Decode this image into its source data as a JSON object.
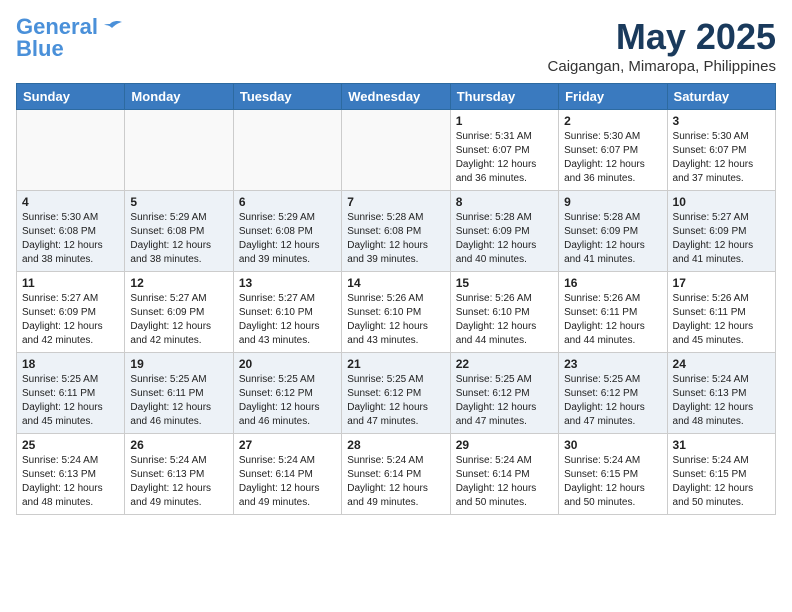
{
  "logo": {
    "line1": "General",
    "line2": "Blue"
  },
  "title": "May 2025",
  "location": "Caigangan, Mimaropa, Philippines",
  "weekdays": [
    "Sunday",
    "Monday",
    "Tuesday",
    "Wednesday",
    "Thursday",
    "Friday",
    "Saturday"
  ],
  "weeks": [
    [
      {
        "day": "",
        "info": ""
      },
      {
        "day": "",
        "info": ""
      },
      {
        "day": "",
        "info": ""
      },
      {
        "day": "",
        "info": ""
      },
      {
        "day": "1",
        "info": "Sunrise: 5:31 AM\nSunset: 6:07 PM\nDaylight: 12 hours\nand 36 minutes."
      },
      {
        "day": "2",
        "info": "Sunrise: 5:30 AM\nSunset: 6:07 PM\nDaylight: 12 hours\nand 36 minutes."
      },
      {
        "day": "3",
        "info": "Sunrise: 5:30 AM\nSunset: 6:07 PM\nDaylight: 12 hours\nand 37 minutes."
      }
    ],
    [
      {
        "day": "4",
        "info": "Sunrise: 5:30 AM\nSunset: 6:08 PM\nDaylight: 12 hours\nand 38 minutes."
      },
      {
        "day": "5",
        "info": "Sunrise: 5:29 AM\nSunset: 6:08 PM\nDaylight: 12 hours\nand 38 minutes."
      },
      {
        "day": "6",
        "info": "Sunrise: 5:29 AM\nSunset: 6:08 PM\nDaylight: 12 hours\nand 39 minutes."
      },
      {
        "day": "7",
        "info": "Sunrise: 5:28 AM\nSunset: 6:08 PM\nDaylight: 12 hours\nand 39 minutes."
      },
      {
        "day": "8",
        "info": "Sunrise: 5:28 AM\nSunset: 6:09 PM\nDaylight: 12 hours\nand 40 minutes."
      },
      {
        "day": "9",
        "info": "Sunrise: 5:28 AM\nSunset: 6:09 PM\nDaylight: 12 hours\nand 41 minutes."
      },
      {
        "day": "10",
        "info": "Sunrise: 5:27 AM\nSunset: 6:09 PM\nDaylight: 12 hours\nand 41 minutes."
      }
    ],
    [
      {
        "day": "11",
        "info": "Sunrise: 5:27 AM\nSunset: 6:09 PM\nDaylight: 12 hours\nand 42 minutes."
      },
      {
        "day": "12",
        "info": "Sunrise: 5:27 AM\nSunset: 6:09 PM\nDaylight: 12 hours\nand 42 minutes."
      },
      {
        "day": "13",
        "info": "Sunrise: 5:27 AM\nSunset: 6:10 PM\nDaylight: 12 hours\nand 43 minutes."
      },
      {
        "day": "14",
        "info": "Sunrise: 5:26 AM\nSunset: 6:10 PM\nDaylight: 12 hours\nand 43 minutes."
      },
      {
        "day": "15",
        "info": "Sunrise: 5:26 AM\nSunset: 6:10 PM\nDaylight: 12 hours\nand 44 minutes."
      },
      {
        "day": "16",
        "info": "Sunrise: 5:26 AM\nSunset: 6:11 PM\nDaylight: 12 hours\nand 44 minutes."
      },
      {
        "day": "17",
        "info": "Sunrise: 5:26 AM\nSunset: 6:11 PM\nDaylight: 12 hours\nand 45 minutes."
      }
    ],
    [
      {
        "day": "18",
        "info": "Sunrise: 5:25 AM\nSunset: 6:11 PM\nDaylight: 12 hours\nand 45 minutes."
      },
      {
        "day": "19",
        "info": "Sunrise: 5:25 AM\nSunset: 6:11 PM\nDaylight: 12 hours\nand 46 minutes."
      },
      {
        "day": "20",
        "info": "Sunrise: 5:25 AM\nSunset: 6:12 PM\nDaylight: 12 hours\nand 46 minutes."
      },
      {
        "day": "21",
        "info": "Sunrise: 5:25 AM\nSunset: 6:12 PM\nDaylight: 12 hours\nand 47 minutes."
      },
      {
        "day": "22",
        "info": "Sunrise: 5:25 AM\nSunset: 6:12 PM\nDaylight: 12 hours\nand 47 minutes."
      },
      {
        "day": "23",
        "info": "Sunrise: 5:25 AM\nSunset: 6:12 PM\nDaylight: 12 hours\nand 47 minutes."
      },
      {
        "day": "24",
        "info": "Sunrise: 5:24 AM\nSunset: 6:13 PM\nDaylight: 12 hours\nand 48 minutes."
      }
    ],
    [
      {
        "day": "25",
        "info": "Sunrise: 5:24 AM\nSunset: 6:13 PM\nDaylight: 12 hours\nand 48 minutes."
      },
      {
        "day": "26",
        "info": "Sunrise: 5:24 AM\nSunset: 6:13 PM\nDaylight: 12 hours\nand 49 minutes."
      },
      {
        "day": "27",
        "info": "Sunrise: 5:24 AM\nSunset: 6:14 PM\nDaylight: 12 hours\nand 49 minutes."
      },
      {
        "day": "28",
        "info": "Sunrise: 5:24 AM\nSunset: 6:14 PM\nDaylight: 12 hours\nand 49 minutes."
      },
      {
        "day": "29",
        "info": "Sunrise: 5:24 AM\nSunset: 6:14 PM\nDaylight: 12 hours\nand 50 minutes."
      },
      {
        "day": "30",
        "info": "Sunrise: 5:24 AM\nSunset: 6:15 PM\nDaylight: 12 hours\nand 50 minutes."
      },
      {
        "day": "31",
        "info": "Sunrise: 5:24 AM\nSunset: 6:15 PM\nDaylight: 12 hours\nand 50 minutes."
      }
    ]
  ]
}
